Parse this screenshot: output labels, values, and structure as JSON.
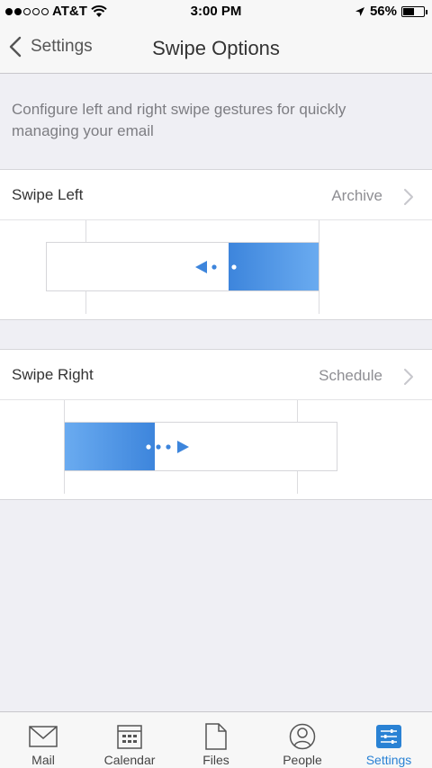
{
  "status": {
    "carrier": "AT&T",
    "time": "3:00 PM",
    "battery": "56%",
    "battery_level": 0.56
  },
  "nav": {
    "back_label": "Settings",
    "title": "Swipe Options"
  },
  "description": "Configure left and right swipe gestures for quickly managing your email",
  "swipe_left": {
    "label": "Swipe Left",
    "value": "Archive"
  },
  "swipe_right": {
    "label": "Swipe Right",
    "value": "Schedule"
  },
  "tabs": [
    {
      "label": "Mail",
      "icon": "mail-icon"
    },
    {
      "label": "Calendar",
      "icon": "calendar-icon"
    },
    {
      "label": "Files",
      "icon": "files-icon"
    },
    {
      "label": "People",
      "icon": "people-icon"
    },
    {
      "label": "Settings",
      "icon": "settings-icon",
      "active": true
    }
  ],
  "colors": {
    "accent": "#2a82d4",
    "swipe_blue": "#3d85dc"
  }
}
